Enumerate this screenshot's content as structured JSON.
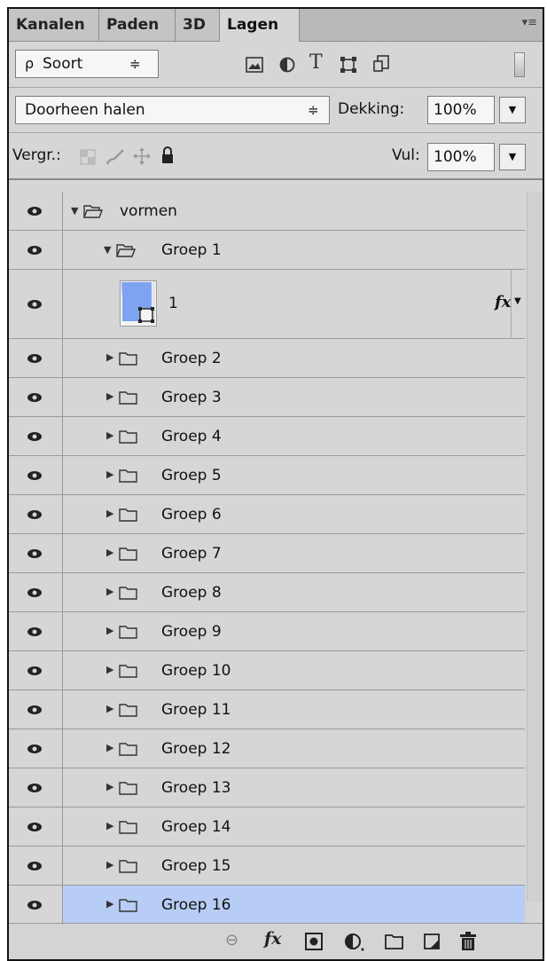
{
  "tabs": [
    {
      "label": "Kanalen"
    },
    {
      "label": "Paden"
    },
    {
      "label": "3D"
    },
    {
      "label": "Lagen"
    }
  ],
  "panel_menu_icon": "panel-menu-icon",
  "filter": {
    "search_glyph": "ρ",
    "kind_label": "Soort",
    "stepper_glyph": "≑",
    "icons": [
      "image-filter-icon",
      "adjustment-filter-icon",
      "type-filter-icon",
      "shape-filter-icon",
      "smart-object-filter-icon"
    ],
    "type_glyph": "T"
  },
  "blend": {
    "mode": "Doorheen halen",
    "opacity_label": "Dekking:",
    "opacity_value": "100%"
  },
  "lock": {
    "label": "Vergr.:",
    "fill_label": "Vul:",
    "fill_value": "100%"
  },
  "layers": [
    {
      "name": "vormen",
      "kind": "group",
      "expanded": true,
      "level": 0
    },
    {
      "name": "Groep 1",
      "kind": "group",
      "expanded": true,
      "level": 1
    },
    {
      "name": "1",
      "kind": "shape",
      "level": 2,
      "fx": "fx"
    },
    {
      "name": "Groep 2",
      "kind": "group",
      "expanded": false,
      "level": 1
    },
    {
      "name": "Groep 3",
      "kind": "group",
      "expanded": false,
      "level": 1
    },
    {
      "name": "Groep 4",
      "kind": "group",
      "expanded": false,
      "level": 1
    },
    {
      "name": "Groep 5",
      "kind": "group",
      "expanded": false,
      "level": 1
    },
    {
      "name": "Groep 6",
      "kind": "group",
      "expanded": false,
      "level": 1
    },
    {
      "name": "Groep 7",
      "kind": "group",
      "expanded": false,
      "level": 1
    },
    {
      "name": "Groep 8",
      "kind": "group",
      "expanded": false,
      "level": 1
    },
    {
      "name": "Groep 9",
      "kind": "group",
      "expanded": false,
      "level": 1
    },
    {
      "name": "Groep 10",
      "kind": "group",
      "expanded": false,
      "level": 1
    },
    {
      "name": "Groep 11",
      "kind": "group",
      "expanded": false,
      "level": 1
    },
    {
      "name": "Groep 12",
      "kind": "group",
      "expanded": false,
      "level": 1
    },
    {
      "name": "Groep 13",
      "kind": "group",
      "expanded": false,
      "level": 1
    },
    {
      "name": "Groep 14",
      "kind": "group",
      "expanded": false,
      "level": 1
    },
    {
      "name": "Groep 15",
      "kind": "group",
      "expanded": false,
      "level": 1
    },
    {
      "name": "Groep 16",
      "kind": "group",
      "expanded": false,
      "level": 1,
      "selected": true
    }
  ],
  "bottom_icons": [
    "link-layers-icon",
    "fx-icon",
    "layer-mask-icon",
    "adjustment-layer-icon",
    "new-group-icon",
    "new-layer-icon",
    "trash-icon"
  ],
  "bottom_fx_label": "fx",
  "colors": {
    "panel_bg": "#d6d6d6",
    "selected_row": "#b7cdf5",
    "thumb_blue": "#7ea3f1"
  }
}
